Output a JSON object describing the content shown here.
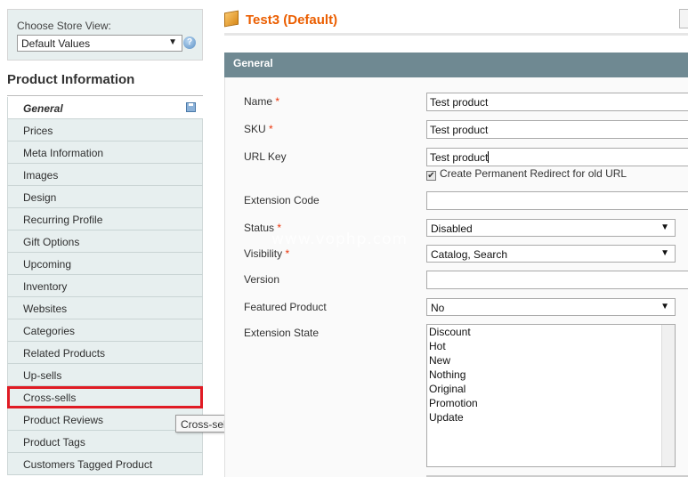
{
  "store": {
    "label": "Choose Store View:",
    "selected": "Default Values"
  },
  "sidebar": {
    "heading": "Product Information",
    "tabs": [
      {
        "label": "General"
      },
      {
        "label": "Prices"
      },
      {
        "label": "Meta Information"
      },
      {
        "label": "Images"
      },
      {
        "label": "Design"
      },
      {
        "label": "Recurring Profile"
      },
      {
        "label": "Gift Options"
      },
      {
        "label": "Upcoming"
      },
      {
        "label": "Inventory"
      },
      {
        "label": "Websites"
      },
      {
        "label": "Categories"
      },
      {
        "label": "Related Products"
      },
      {
        "label": "Up-sells"
      },
      {
        "label": "Cross-sells"
      },
      {
        "label": "Product Reviews"
      },
      {
        "label": "Product Tags"
      },
      {
        "label": "Customers Tagged Product"
      }
    ],
    "tooltip": "Cross-sells"
  },
  "header": {
    "title": "Test3 (Default)"
  },
  "section": {
    "title": "General"
  },
  "form": {
    "name_label": "Name",
    "name_value": "Test product",
    "sku_label": "SKU",
    "sku_value": "Test product",
    "url_key_label": "URL Key",
    "url_key_value": "Test product",
    "redirect_label": "Create Permanent Redirect for old URL",
    "extension_code_label": "Extension Code",
    "extension_code_value": "",
    "status_label": "Status",
    "status_value": "Disabled",
    "visibility_label": "Visibility",
    "visibility_value": "Catalog, Search",
    "version_label": "Version",
    "version_value": "",
    "featured_label": "Featured Product",
    "featured_value": "No",
    "extension_state_label": "Extension State",
    "extension_state_options": [
      "Discount",
      "Hot",
      "New",
      "Nothing",
      "Original",
      "Promotion",
      "Update"
    ],
    "required_mark": "*"
  },
  "watermark": "www.vophp.com",
  "colors": {
    "accent_orange": "#eb5e00",
    "section_header": "#6f8992",
    "sidebar_bg": "#e7efef",
    "highlight_red": "#e01b24"
  }
}
